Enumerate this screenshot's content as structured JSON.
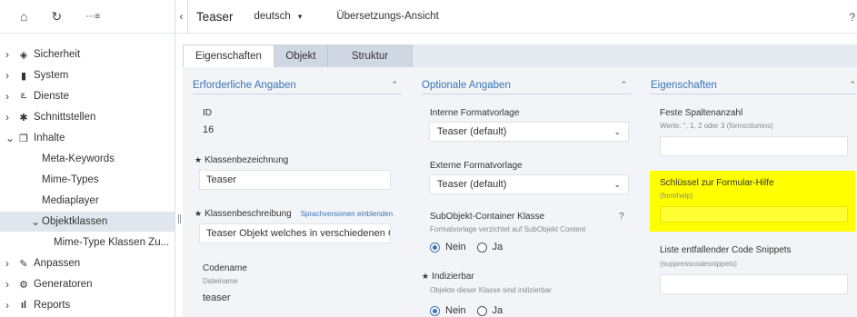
{
  "sidebar": {
    "toolbar": {
      "home": "⌂",
      "refresh": "↻",
      "filter": "⋯≡"
    },
    "items": [
      {
        "label": "Sicherheit",
        "icon": "shield",
        "glyph": "◈",
        "chevron": "›"
      },
      {
        "label": "System",
        "icon": "server",
        "glyph": "▮",
        "chevron": "›"
      },
      {
        "label": "Dienste",
        "icon": "services",
        "glyph": "ఽ",
        "chevron": "›"
      },
      {
        "label": "Schnittstellen",
        "icon": "puzzle",
        "glyph": "✱",
        "chevron": "›"
      },
      {
        "label": "Inhalte",
        "icon": "copy",
        "glyph": "❐",
        "chevron": "⌄"
      },
      {
        "label": "Meta-Keywords"
      },
      {
        "label": "Mime-Types"
      },
      {
        "label": "Mediaplayer"
      },
      {
        "label": "Objektklassen",
        "chevron": "⌄"
      },
      {
        "label": "Mime-Type Klassen Zu..."
      },
      {
        "label": "Anpassen",
        "icon": "wrench",
        "glyph": "✎",
        "chevron": "›"
      },
      {
        "label": "Generatoren",
        "icon": "gear",
        "glyph": "⚙",
        "chevron": "›"
      },
      {
        "label": "Reports",
        "icon": "bar-chart",
        "glyph": "ıl",
        "chevron": "›"
      }
    ]
  },
  "header": {
    "back": "‹",
    "title": "Teaser",
    "language": "deutsch",
    "language_caret": "▾",
    "translation_view": "Übersetzungs-Ansicht",
    "help": "?"
  },
  "tabs": [
    {
      "label": "Eigenschaften",
      "active": true
    },
    {
      "label": "Objekt",
      "active": false
    },
    {
      "label": "Struktur",
      "active": false
    }
  ],
  "col1": {
    "title": "Erforderliche Angaben",
    "collapse": "⌃",
    "id_label": "ID",
    "id_value": "16",
    "req": "★",
    "klassenbez_label": "Klassenbezeichnung",
    "klassenbez_value": "Teaser",
    "klassenbeschr_label": "Klassenbeschreibung",
    "sprachversionen_link": "Sprachversionen einblenden",
    "klassenbeschr_value": "Teaser Objekt welches in verschiedenen Ob...",
    "codename_label": "Codename",
    "codename_hint": "Dateiname",
    "codename_value": "teaser"
  },
  "col2": {
    "title": "Optionale Angaben",
    "collapse": "⌃",
    "interne_label": "Interne Formatvorlage",
    "interne_value": "Teaser (default)",
    "externe_label": "Externe Formatvorlage",
    "externe_value": "Teaser (default)",
    "caret": "⌄",
    "subobj_label": "SubObjekt-Container Klasse",
    "subobj_help": "?",
    "subobj_hint": "Formatvorlage verzichtet auf SubObjekt Content",
    "radio_nein": "Nein",
    "radio_ja": "Ja",
    "req": "★",
    "indiz_label": "Indizierbar",
    "indiz_hint": "Objekte dieser Klasse sind indizierbar"
  },
  "col3": {
    "title": "Eigenschaften",
    "collapse": "⌃",
    "spalten_label": "Feste Spaltenanzahl",
    "spalten_hint": "Werte: '', 1, 2 oder 3 (formcolumns)",
    "schluessel_label": "Schlüssel zur Formular-Hilfe",
    "schluessel_hint": "(formhelp)",
    "snippets_label": "Liste entfallender Code Snippets",
    "snippets_hint": "(suppresscodesnippets)"
  },
  "colors": {
    "accent": "#3a74b8",
    "highlight": "#ffff00",
    "content_bg": "#f2f4f7",
    "sidebar_active": "#dfe6ee"
  }
}
